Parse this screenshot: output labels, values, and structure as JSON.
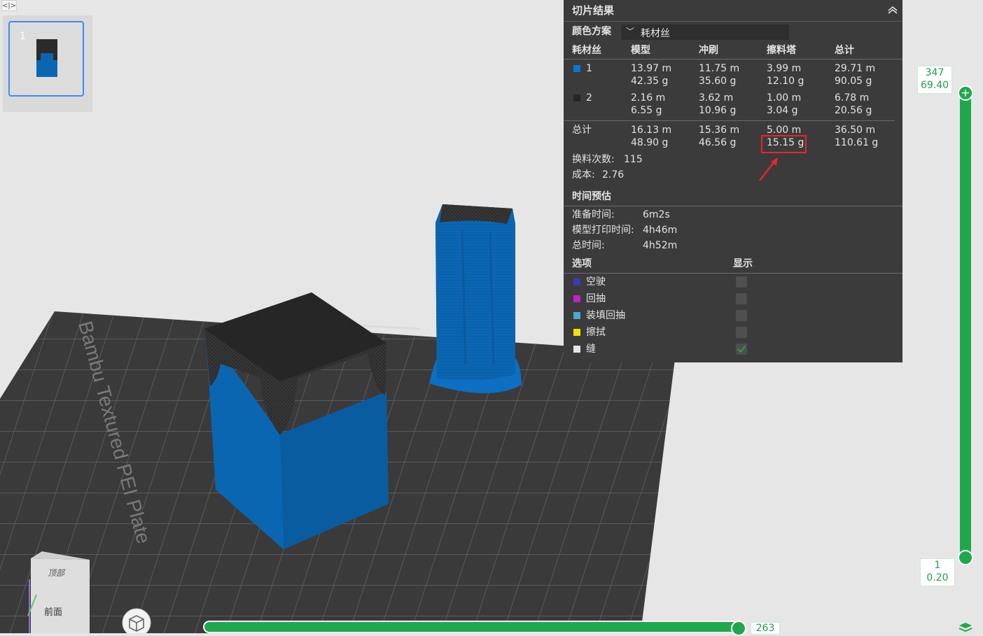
{
  "panel": {
    "title": "切片结果",
    "color_scheme_label": "颜色方案",
    "color_scheme_value": "耗材丝",
    "table_headers": [
      "耗材丝",
      "模型",
      "冲刷",
      "擦料塔",
      "总计"
    ],
    "rows": [
      {
        "name": "1",
        "color": "#0a74d8",
        "model": [
          "13.97 m",
          "42.35 g"
        ],
        "flush": [
          "11.75 m",
          "35.60 g"
        ],
        "tower": [
          "3.99 m",
          "12.10 g"
        ],
        "total": [
          "29.71 m",
          "90.05 g"
        ]
      },
      {
        "name": "2",
        "color": "#262626",
        "model": [
          "2.16 m",
          "6.55 g"
        ],
        "flush": [
          "3.62 m",
          "10.96 g"
        ],
        "tower": [
          "1.00 m",
          "3.04 g"
        ],
        "total": [
          "6.78 m",
          "20.56 g"
        ]
      },
      {
        "name": "总计",
        "model": [
          "16.13 m",
          "48.90 g"
        ],
        "flush": [
          "15.36 m",
          "46.56 g"
        ],
        "tower": [
          "5.00 m",
          "15.15 g"
        ],
        "total": [
          "36.50 m",
          "110.61 g"
        ]
      }
    ],
    "changes_label": "换料次数:",
    "changes_value": "115",
    "cost_label": "成本:",
    "cost_value": "2.76",
    "time_title": "时间预估",
    "prep_label": "准备时间:",
    "prep_value": "6m2s",
    "model_time_label": "模型打印时间:",
    "model_time_value": "4h46m",
    "total_time_label": "总时间:",
    "total_time_value": "4h52m",
    "options_header": "选项",
    "display_header": "显示",
    "options": [
      {
        "label": "空驶",
        "color": "#3a3ab8",
        "checked": false
      },
      {
        "label": "回抽",
        "color": "#c51fc5",
        "checked": false
      },
      {
        "label": "装填回抽",
        "color": "#4aa8d6",
        "checked": false
      },
      {
        "label": "擦拭",
        "color": "#f5e400",
        "checked": false
      },
      {
        "label": "缝",
        "color": "#e6e6e6",
        "checked": true
      }
    ]
  },
  "plate": {
    "number": "1",
    "bed_text": "Bambu Textured PEI Plate"
  },
  "vertical_slider": {
    "top_layer": "347",
    "top_height": "69.40",
    "bottom_layer": "1",
    "bottom_height": "0.20"
  },
  "horizontal_slider": {
    "value": "263"
  },
  "view_cube": {
    "top": "顶部",
    "front": "前面"
  },
  "colors": {
    "accent_green": "#1fa74c",
    "filament_blue": "#0a66b0",
    "filament_black": "#232323",
    "highlight_red": "#e8262e"
  }
}
